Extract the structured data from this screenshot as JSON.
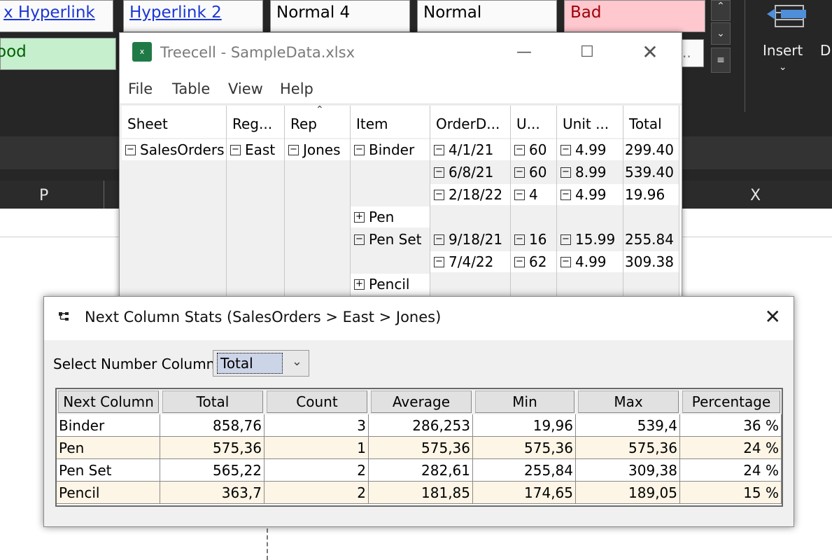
{
  "excel": {
    "styles": [
      "x  Hyperlink",
      "Hyperlink 2",
      "Normal 4",
      "Normal",
      "Bad"
    ],
    "good_label": "ood",
    "partial_cell": "..",
    "columns": [
      "P",
      "X"
    ],
    "ribbon_insert": "Insert",
    "ribbon_partial": "D"
  },
  "tree_window": {
    "title": "Treecell - SampleData.xlsx",
    "app_icon_text": "x",
    "menu": [
      "File",
      "Table",
      "View",
      "Help"
    ],
    "headers": [
      "Sheet",
      "Reg...",
      "Rep",
      "Item",
      "OrderD...",
      "U...",
      "Unit ...",
      "Total"
    ],
    "rows": [
      {
        "sheet": "SalesOrders",
        "region": "East",
        "rep": "Jones",
        "item": "Binder",
        "order_date": "4/1/21",
        "units": "60",
        "unit_cost": "4.99",
        "total": "299.40"
      },
      {
        "order_date": "6/8/21",
        "units": "60",
        "unit_cost": "8.99",
        "total": "539.40"
      },
      {
        "order_date": "2/18/22",
        "units": "4",
        "unit_cost": "4.99",
        "total": "19.96"
      },
      {
        "item": "Pen"
      },
      {
        "item": "Pen Set",
        "order_date": "9/18/21",
        "units": "16",
        "unit_cost": "15.99",
        "total": "255.84"
      },
      {
        "order_date": "7/4/22",
        "units": "62",
        "unit_cost": "4.99",
        "total": "309.38"
      },
      {
        "item": "Pencil"
      }
    ]
  },
  "stats_dialog": {
    "title": "Next Column Stats (SalesOrders > East > Jones)",
    "select_label": "Select Number Column",
    "select_value": "Total",
    "headers": [
      "Next Column",
      "Total",
      "Count",
      "Average",
      "Min",
      "Max",
      "Percentage"
    ],
    "rows": [
      [
        "Binder",
        "858,76",
        "3",
        "286,253",
        "19,96",
        "539,4",
        "36 %"
      ],
      [
        "Pen",
        "575,36",
        "1",
        "575,36",
        "575,36",
        "575,36",
        "24 %"
      ],
      [
        "Pen Set",
        "565,22",
        "2",
        "282,61",
        "255,84",
        "309,38",
        "24 %"
      ],
      [
        "Pencil",
        "363,7",
        "2",
        "181,85",
        "174,65",
        "189,05",
        "15 %"
      ]
    ]
  }
}
